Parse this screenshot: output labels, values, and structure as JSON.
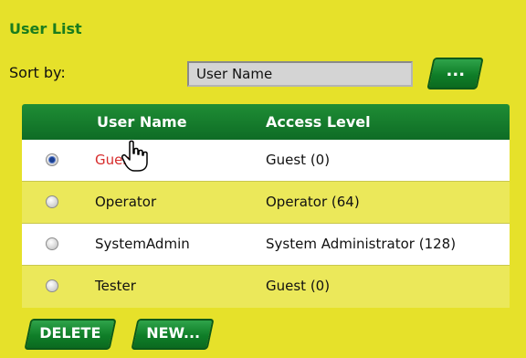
{
  "panel": {
    "title": "User List",
    "sort_label": "Sort by:",
    "sort_value": "User Name",
    "sort_button_label": "..."
  },
  "table": {
    "headers": [
      "User Name",
      "Access Level"
    ],
    "rows": [
      {
        "name": "Guest",
        "access": "Guest (0)",
        "selected": true
      },
      {
        "name": "Operator",
        "access": "Operator (64)",
        "selected": false
      },
      {
        "name": "SystemAdmin",
        "access": "System Administrator (128)",
        "selected": false
      },
      {
        "name": "Tester",
        "access": "Guest (0)",
        "selected": false
      }
    ]
  },
  "actions": {
    "delete_label": "DELETE",
    "new_label": "NEW..."
  },
  "colors": {
    "background": "#e6e12a",
    "header_green": "#0e6c25",
    "title_green": "#1a7c1d",
    "link_red": "#d72d2d"
  },
  "icons": {
    "cursor": "hand-pointer-icon"
  }
}
